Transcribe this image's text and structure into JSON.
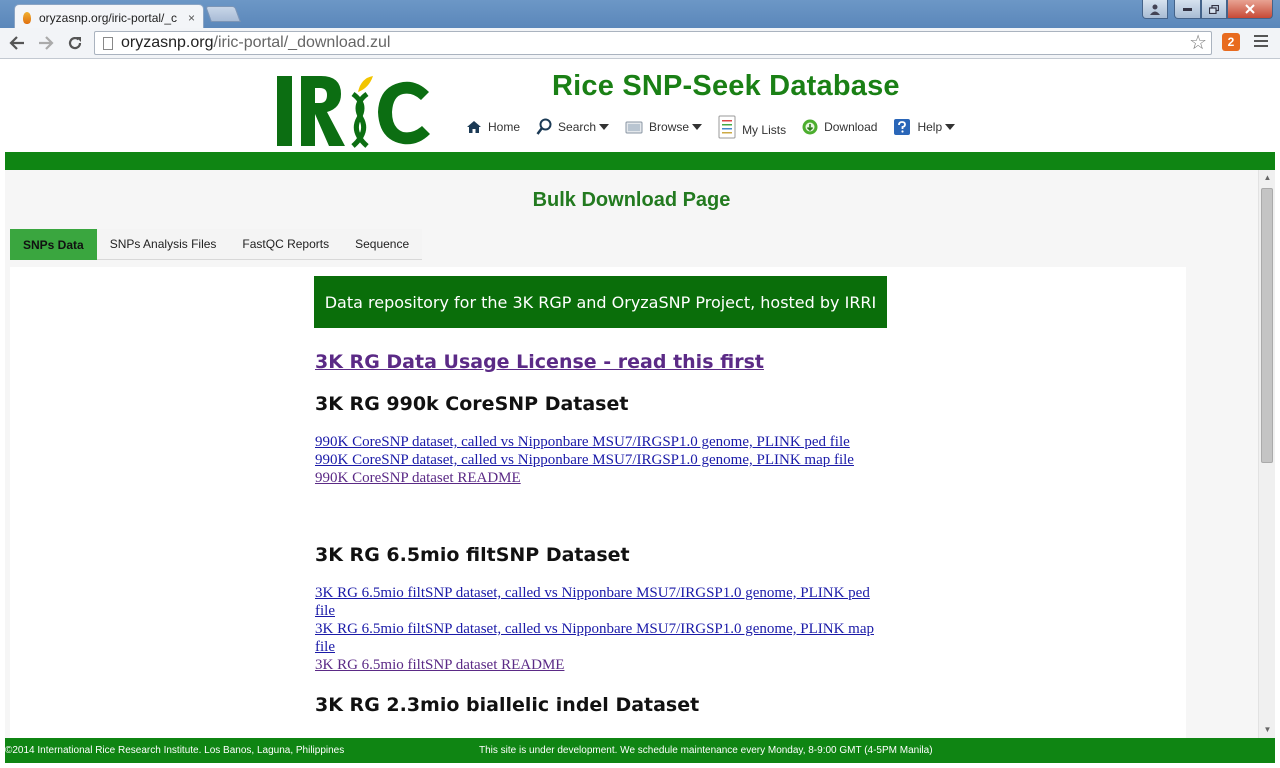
{
  "browser": {
    "tab_title": "oryzasnp.org/iric-portal/_c",
    "tab_close": "×",
    "url_host": "oryzasnp.org",
    "url_path": "/iric-portal/_download.zul",
    "back_icon": "back-arrow-icon",
    "forward_icon": "forward-arrow-icon",
    "reload_icon": "reload-icon",
    "bookmark_icon": "star-icon",
    "extension_icon": "extension-icon",
    "menu_icon": "hamburger-menu-icon"
  },
  "site": {
    "logo_text": "IRIC",
    "title": "Rice SNP-Seek Database",
    "nav": [
      {
        "label": "Home",
        "icon": "home-icon",
        "dropdown": false
      },
      {
        "label": "Search",
        "icon": "search-icon",
        "dropdown": true
      },
      {
        "label": "Browse",
        "icon": "browse-icon",
        "dropdown": true
      },
      {
        "label": "My Lists",
        "icon": "list-icon",
        "dropdown": false
      },
      {
        "label": "Download",
        "icon": "download-icon",
        "dropdown": false
      },
      {
        "label": "Help",
        "icon": "help-icon",
        "dropdown": true
      }
    ]
  },
  "page": {
    "heading": "Bulk Download Page",
    "tabs": [
      {
        "label": "SNPs Data",
        "active": true
      },
      {
        "label": "SNPs Analysis Files",
        "active": false
      },
      {
        "label": "FastQC Reports",
        "active": false
      },
      {
        "label": "Sequence",
        "active": false
      }
    ],
    "repo_banner": "Data repository for the 3K RGP and OryzaSNP Project, hosted by IRRI",
    "license_link": "3K RG Data Usage License - read this first",
    "datasets": [
      {
        "title": "3K RG 990k CoreSNP Dataset",
        "links": [
          {
            "text": "990K CoreSNP dataset, called vs Nipponbare MSU7/IRGSP1.0 genome, PLINK ped file",
            "visited": false
          },
          {
            "text": "990K CoreSNP dataset, called vs Nipponbare MSU7/IRGSP1.0 genome, PLINK map file",
            "visited": false
          },
          {
            "text": "990K CoreSNP dataset README",
            "visited": true
          }
        ]
      },
      {
        "title": "3K RG 6.5mio filtSNP Dataset",
        "links": [
          {
            "text": "3K RG 6.5mio filtSNP dataset, called vs Nipponbare MSU7/IRGSP1.0 genome, PLINK ped file",
            "visited": false
          },
          {
            "text": "3K RG 6.5mio filtSNP dataset, called vs Nipponbare MSU7/IRGSP1.0 genome, PLINK map file",
            "visited": false
          },
          {
            "text": "3K RG 6.5mio filtSNP dataset README",
            "visited": true
          }
        ]
      },
      {
        "title": "3K RG 2.3mio biallelic indel Dataset",
        "links": []
      }
    ]
  },
  "footer": {
    "left": "©2014 International Rice Research Institute. Los Banos, Laguna, Philippines",
    "right": "This site is under development. We schedule maintenance every Monday, 8-9:00 GMT (4-5PM Manila)"
  },
  "colors": {
    "brand_green": "#1a8015",
    "band_green": "#0f8513",
    "active_tab": "#3aa63f",
    "link": "#1a1aa8",
    "visited_link": "#5b2a86"
  }
}
